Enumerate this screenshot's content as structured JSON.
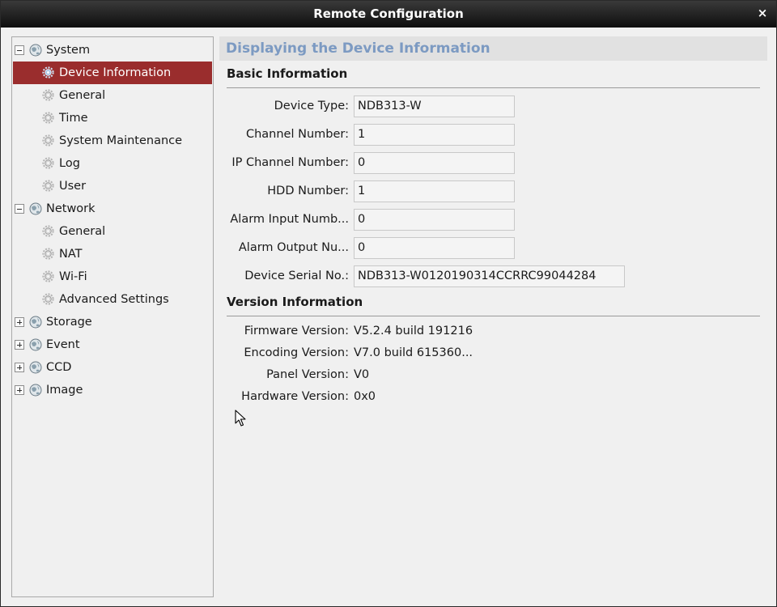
{
  "window": {
    "title": "Remote Configuration",
    "close_label": "×"
  },
  "tree": {
    "groups": [
      {
        "label": "System",
        "expanded": true,
        "children": [
          {
            "label": "Device Information",
            "selected": true
          },
          {
            "label": "General"
          },
          {
            "label": "Time"
          },
          {
            "label": "System Maintenance"
          },
          {
            "label": "Log"
          },
          {
            "label": "User"
          }
        ]
      },
      {
        "label": "Network",
        "expanded": true,
        "children": [
          {
            "label": "General"
          },
          {
            "label": "NAT"
          },
          {
            "label": "Wi-Fi"
          },
          {
            "label": "Advanced Settings"
          }
        ]
      },
      {
        "label": "Storage",
        "expanded": false
      },
      {
        "label": "Event",
        "expanded": false
      },
      {
        "label": "CCD",
        "expanded": false
      },
      {
        "label": "Image",
        "expanded": false
      }
    ]
  },
  "content": {
    "header": "Displaying the Device Information",
    "basic": {
      "title": "Basic Information",
      "fields": [
        {
          "label": "Device Type:",
          "value": "NDB313-W"
        },
        {
          "label": "Channel Number:",
          "value": "1"
        },
        {
          "label": "IP Channel Number:",
          "value": "0"
        },
        {
          "label": "HDD Number:",
          "value": "1"
        },
        {
          "label": "Alarm Input Numb...",
          "value": "0"
        },
        {
          "label": "Alarm Output Nu...",
          "value": "0"
        },
        {
          "label": "Device Serial No.:",
          "value": "NDB313-W0120190314CCRRC99044284"
        }
      ]
    },
    "version": {
      "title": "Version Information",
      "fields": [
        {
          "label": "Firmware Version:",
          "value": "V5.2.4 build 191216"
        },
        {
          "label": "Encoding Version:",
          "value": "V7.0 build 615360..."
        },
        {
          "label": "Panel Version:",
          "value": "V0"
        },
        {
          "label": "Hardware Version:",
          "value": "0x0"
        }
      ]
    }
  },
  "colors": {
    "selected_bg": "#9a2d2d",
    "header_text": "#7c9ac2",
    "titlebar": "#1e1e1e"
  },
  "icons": {
    "group": "globe-icon",
    "child": "gear-icon",
    "close": "close-icon",
    "cursor": "mouse-pointer-icon"
  }
}
